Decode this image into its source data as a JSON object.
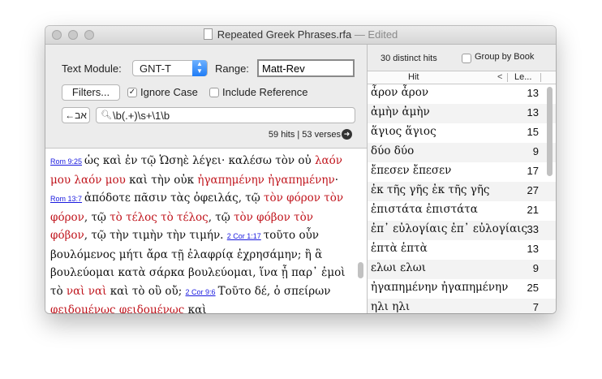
{
  "window": {
    "filename": "Repeated Greek Phrases.rfa",
    "edited": "— Edited"
  },
  "toolbar": {
    "text_module_label": "Text Module:",
    "text_module_value": "GNT-T",
    "range_label": "Range:",
    "range_value": "Matt-Rev",
    "filters_label": "Filters...",
    "ignore_case_label": "Ignore Case",
    "ignore_case_checked": true,
    "include_reference_label": "Include Reference",
    "include_reference_checked": false,
    "direction_button": "←אב",
    "search_query": "\\b(.+)\\s+\\1\\b",
    "hits_summary": "59 hits | 53 verses"
  },
  "text_pane": {
    "verses": [
      {
        "ref": "Rom 9:25",
        "parts": [
          {
            "t": "ὡς καὶ ἐν τῷ Ὡσηὲ λέγει· καλέσω τὸν οὐ ",
            "h": false
          },
          {
            "t": "λαόν μου λαόν μου",
            "h": true
          },
          {
            "t": " καὶ τὴν οὐκ ",
            "h": false
          },
          {
            "t": "ἠγαπημένην ἠγαπημένην",
            "h": true
          },
          {
            "t": "·",
            "h": false
          }
        ]
      },
      {
        "ref": "Rom 13:7",
        "parts": [
          {
            "t": "ἀπόδοτε πᾶσιν τὰς ὀφειλάς, τῷ ",
            "h": false
          },
          {
            "t": "τὸν φόρον τὸν φόρον",
            "h": true
          },
          {
            "t": ", τῷ ",
            "h": false
          },
          {
            "t": "τὸ τέλος τὸ τέλος",
            "h": true
          },
          {
            "t": ", τῷ ",
            "h": false
          },
          {
            "t": "τὸν φόβον τὸν φόβον",
            "h": true
          },
          {
            "t": ", τῷ τὴν τιμὴν τὴν τιμήν.",
            "h": false
          }
        ]
      },
      {
        "ref": "2 Cor 1:17",
        "parts": [
          {
            "t": "τοῦτο οὖν βουλόμενος μήτι ἄρα τῇ ἐλαφρίᾳ ἐχρησάμην; ἢ ἃ βουλεύομαι κατὰ σάρκα βουλεύομαι, ἵνα ᾖ παρ᾽ ἐμοὶ τὸ ",
            "h": false
          },
          {
            "t": "ναὶ ναὶ",
            "h": true
          },
          {
            "t": " καὶ τὸ οὒ οὔ;",
            "h": false
          }
        ]
      },
      {
        "ref": "2 Cor 9:6",
        "parts": [
          {
            "t": "Τοῦτο δέ, ὁ σπείρων ",
            "h": false
          },
          {
            "t": "φειδομένως φειδομένως",
            "h": true
          },
          {
            "t": " καὶ",
            "h": false
          }
        ]
      }
    ]
  },
  "hits_panel": {
    "distinct_label": "30 distinct hits",
    "group_by_book_label": "Group by Book",
    "group_by_book_checked": false,
    "col_hit": "Hit",
    "col_len": "Le...",
    "rows": [
      {
        "hit": "ἆρον ἆρον",
        "count": "13"
      },
      {
        "hit": "ἀμὴν ἀμὴν",
        "count": "13"
      },
      {
        "hit": "ἅγιος ἅγιος",
        "count": "15"
      },
      {
        "hit": "δύο δύο",
        "count": "9"
      },
      {
        "hit": "ἔπεσεν ἔπεσεν",
        "count": "17"
      },
      {
        "hit": "ἐκ τῆς γῆς ἐκ τῆς γῆς",
        "count": "27"
      },
      {
        "hit": "ἐπιστάτα ἐπιστάτα",
        "count": "21"
      },
      {
        "hit": "ἐπ᾽ εὐλογίαις ἐπ᾽ εὐλογίαις",
        "count": "33"
      },
      {
        "hit": "ἑπτὰ ἑπτὰ",
        "count": "13"
      },
      {
        "hit": "ελωι ελωι",
        "count": "9"
      },
      {
        "hit": "ἠγαπημένην ἠγαπημένην",
        "count": "25"
      },
      {
        "hit": "ηλι ηλι",
        "count": "7"
      }
    ]
  }
}
